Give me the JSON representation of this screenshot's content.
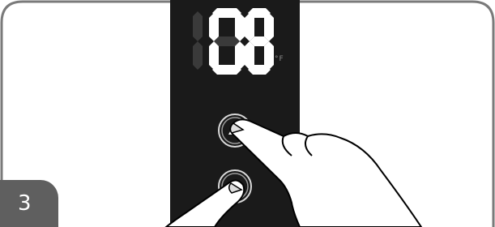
{
  "illustration": {
    "description_icon": "hand-pressing-up-down-buttons",
    "panel_color": "#1a1a1a",
    "segment_color_on": "#ffffff",
    "segment_color_off": "#3a3a3a",
    "frame_color": "#7a7a7a"
  },
  "display": {
    "temperature": "108",
    "unit": "°F"
  },
  "buttons": {
    "up_icon": "triangle-up-icon",
    "down_icon": "triangle-down-icon"
  },
  "step": {
    "number": "3"
  }
}
